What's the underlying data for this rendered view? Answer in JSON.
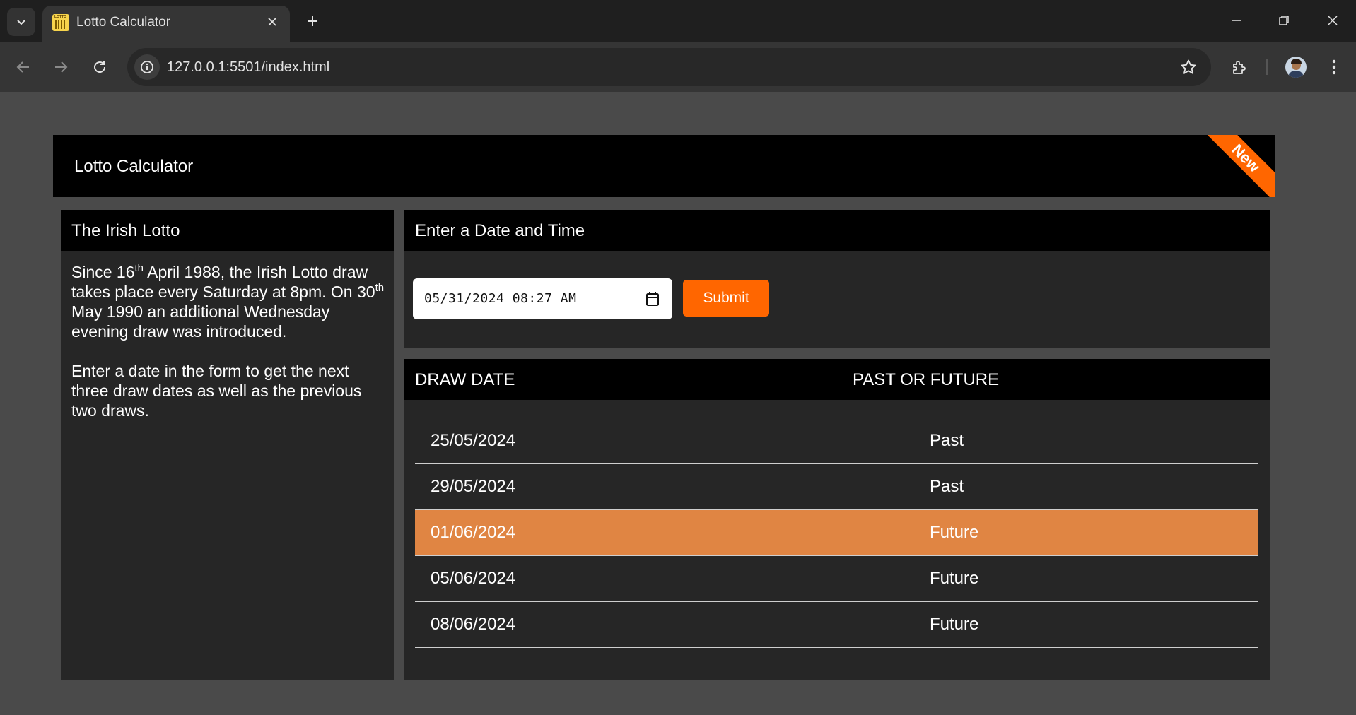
{
  "browser": {
    "tab_title": "Lotto Calculator",
    "favicon_label": "LOTTO",
    "url": "127.0.0.1:5501/index.html"
  },
  "header": {
    "title": "Lotto Calculator",
    "ribbon": "New",
    "ribbon_color": "#ff6600"
  },
  "info_panel": {
    "title": "The Irish Lotto",
    "p1_a": "Since 16",
    "p1_sup1": "th",
    "p1_b": " April 1988, the Irish Lotto draw takes place every Saturday at 8pm. On 30",
    "p1_sup2": "th",
    "p1_c": " May 1990 an additional Wednesday evening draw was introduced.",
    "p2": "Enter a date in the form to get the next three draw dates as well as the previous two draws."
  },
  "form": {
    "title": "Enter a Date and Time",
    "datetime_value": "05/31/2024 08:27 AM",
    "submit_label": "Submit"
  },
  "table": {
    "headers": [
      "DRAW DATE",
      "PAST OR FUTURE"
    ],
    "rows": [
      {
        "date": "25/05/2024",
        "status": "Past"
      },
      {
        "date": "29/05/2024",
        "status": "Past"
      },
      {
        "date": "01/06/2024",
        "status": "Future"
      },
      {
        "date": "05/06/2024",
        "status": "Future"
      },
      {
        "date": "08/06/2024",
        "status": "Future"
      }
    ],
    "highlight_color": "#e08543"
  }
}
